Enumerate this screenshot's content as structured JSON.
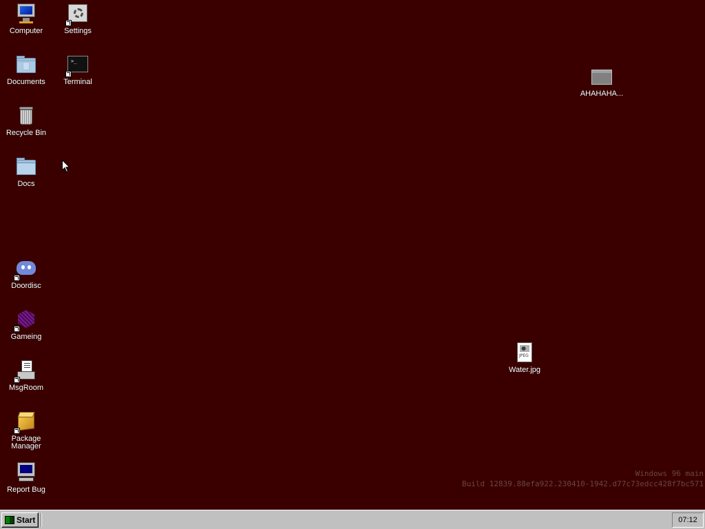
{
  "desktop": {
    "background_color": "#3a0000",
    "icons": {
      "computer": {
        "label": "Computer",
        "icon": "computer-icon"
      },
      "settings": {
        "label": "Settings",
        "icon": "settings-icon",
        "shortcut": true
      },
      "documents": {
        "label": "Documents",
        "icon": "folder-icon"
      },
      "terminal": {
        "label": "Terminal",
        "icon": "terminal-icon",
        "shortcut": true
      },
      "recycle_bin": {
        "label": "Recycle Bin",
        "icon": "recycle-bin-icon"
      },
      "docs": {
        "label": "Docs",
        "icon": "folder-icon"
      },
      "doordisc": {
        "label": "Doordisc",
        "icon": "discord-icon",
        "shortcut": true
      },
      "gameing": {
        "label": "Gameing",
        "icon": "game-cube-icon",
        "shortcut": true
      },
      "msgroom": {
        "label": "MsgRoom",
        "icon": "message-terminal-icon",
        "shortcut": true
      },
      "package_manager": {
        "label": "Package Manager",
        "icon": "package-icon",
        "shortcut": true
      },
      "report_bug": {
        "label": "Report Bug",
        "icon": "computer-bug-icon"
      },
      "ahahaha": {
        "label": "AHAHAHA...",
        "icon": "window-icon"
      },
      "water": {
        "label": "Water.jpg",
        "icon": "jpeg-file-icon"
      }
    },
    "jpeg_tag": "JPEG",
    "terminal_prompt": ">_"
  },
  "watermark": {
    "line1": "Windows 96 main",
    "line2": "Build 12839.88efa922.230410-1942.d77c73edcc428f7bc571"
  },
  "taskbar": {
    "start_label": "Start",
    "clock": "07:12"
  }
}
